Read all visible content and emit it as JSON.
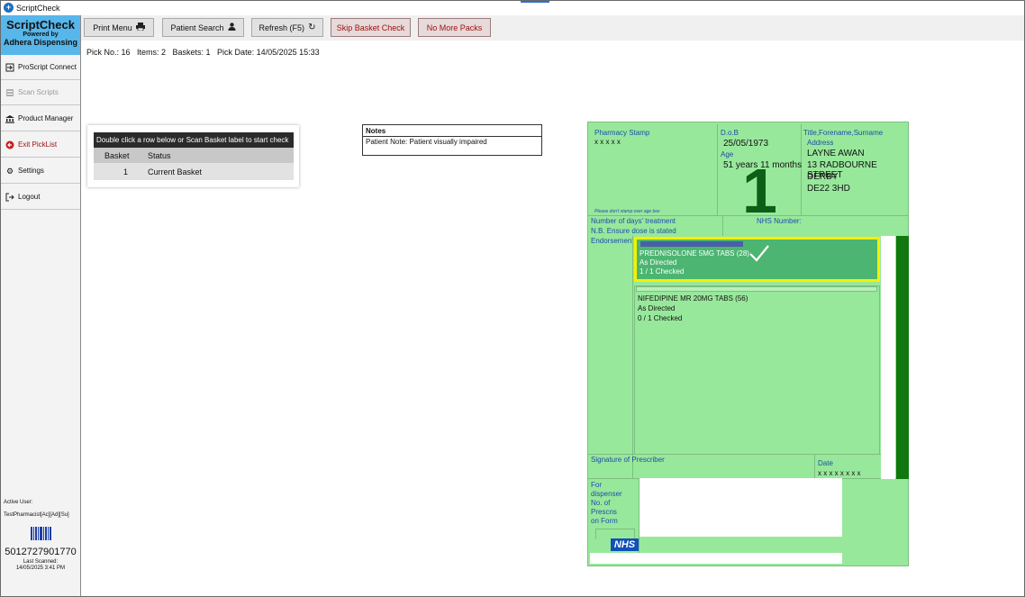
{
  "window": {
    "title": "ScriptCheck"
  },
  "brand": {
    "name": "ScriptCheck",
    "powered": "Powered by",
    "company": "Adhera Dispensing"
  },
  "sidebar": {
    "items": [
      {
        "label": "ProScript Connect",
        "icon": "login-icon",
        "disabled": false
      },
      {
        "label": "Scan Scripts",
        "icon": "scanner-icon",
        "disabled": true
      },
      {
        "label": "Product Manager",
        "icon": "bank-icon",
        "disabled": false
      },
      {
        "label": "Exit PickList",
        "icon": "exit-circle-icon",
        "disabled": false
      },
      {
        "label": "Settings",
        "icon": "gear-icon",
        "disabled": false
      },
      {
        "label": "Logout",
        "icon": "logout-icon",
        "disabled": false
      }
    ],
    "active_user_label": "Active User:",
    "active_user": "TestPharmacist[Ac][Ad][Su]",
    "scanned_code": "5012727901770",
    "last_scanned": "Last Scanned: 14/05/2025 3:41 PM"
  },
  "toolbar": {
    "print_menu": "Print Menu",
    "patient_search": "Patient Search",
    "refresh": "Refresh (F5)",
    "skip_basket_check": "Skip Basket Check",
    "no_more_packs": "No More Packs"
  },
  "pick_info": "Pick No.: 16   Items: 2   Baskets: 1   Pick Date: 14/05/2025 15:33",
  "basket_panel": {
    "header": "Double click a row below or Scan Basket label to start check",
    "columns": [
      "Basket",
      "Status"
    ],
    "rows": [
      {
        "basket": "1",
        "status": "Current Basket"
      }
    ]
  },
  "notes": {
    "title": "Notes",
    "text": "Patient Note:  Patient visually impaired"
  },
  "prescription": {
    "pharmacy_stamp_label": "Pharmacy Stamp",
    "pharmacy_stamp_value": "x x x x x",
    "stamp_note": "Please don't stamp over age box",
    "dob_label": "D.o.B",
    "dob": "25/05/1973",
    "age_label": "Age",
    "age": "51 years 11 months",
    "big_number": "1",
    "name_label": "Title,Forename,Surname",
    "address_label": "Address",
    "patient_name": "LAYNE AWAN",
    "address_line1": "13 RADBOURNE STREET",
    "address_line2": "DERBY",
    "postcode": "DE22 3HD",
    "days_treatment": "Number of days' treatment",
    "ensure_dose": "N.B. Ensure dose is stated",
    "nhs_number_label": "NHS Number:",
    "endorsements": "Endorsements",
    "items": [
      {
        "name": "PREDNISOLONE 5MG TABS (28)",
        "directions": "As Directed",
        "checked": "1 / 1 Checked"
      },
      {
        "name": "NIFEDIPINE MR 20MG TABS (56)",
        "directions": "As Directed",
        "checked": "0 / 1 Checked"
      }
    ],
    "signature_label": "Signature of Prescriber",
    "date_label": "Date",
    "date_value": "x x x x x x x x",
    "dispenser_lines": [
      "For",
      "dispenser",
      "No. of",
      "Prescns",
      "on Form"
    ],
    "nhs_logo": "NHS"
  }
}
